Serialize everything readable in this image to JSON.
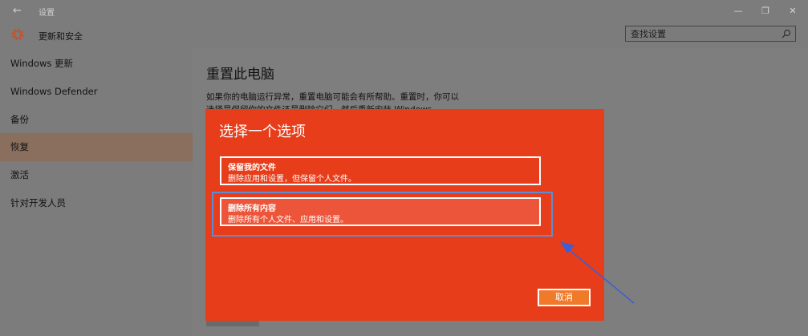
{
  "window": {
    "title": "设置",
    "back_icon": "back-arrow-icon",
    "controls": [
      "minimize-icon",
      "maximize-icon",
      "close-icon"
    ]
  },
  "header": {
    "icon": "gear-icon",
    "section_title": "更新和安全",
    "search": {
      "placeholder": "查找设置",
      "value": "",
      "icon": "search-icon"
    }
  },
  "sidebar": {
    "items": [
      {
        "label": "Windows 更新",
        "active": false
      },
      {
        "label": "Windows Defender",
        "active": false
      },
      {
        "label": "备份",
        "active": false
      },
      {
        "label": "恢复",
        "active": true
      },
      {
        "label": "激活",
        "active": false
      },
      {
        "label": "针对开发人员",
        "active": false
      }
    ]
  },
  "main": {
    "title": "重置此电脑",
    "description": "如果你的电脑运行异常，重置电脑可能会有所帮助。重置时，你可以选择是保留你的文件还是删除它们，然后重新安装 Windows。"
  },
  "dialog": {
    "title": "选择一个选项",
    "options": [
      {
        "title": "保留我的文件",
        "description": "删除应用和设置，但保留个人文件。",
        "selected": false
      },
      {
        "title": "删除所有内容",
        "description": "删除所有个人文件、应用和设置。",
        "selected": true
      }
    ],
    "cancel_label": "取消"
  },
  "colors": {
    "dialog_bg": "#e73d1a",
    "selection_ring": "#5b8ed6",
    "annotation_arrow": "#3f5fd0",
    "cancel_bg": "#f07a2a"
  }
}
